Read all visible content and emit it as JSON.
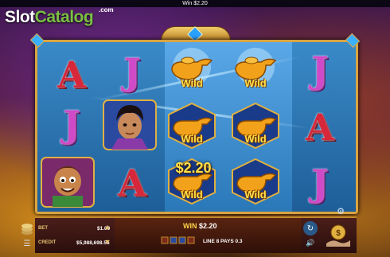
{
  "top": {
    "win_label": "Win $2.20"
  },
  "logo": {
    "part1": "Slot",
    "part2": "Catalog",
    "suffix": ".com"
  },
  "reels": [
    [
      "A",
      "J",
      "character-boy"
    ],
    [
      "J",
      "character-aladdin",
      "A"
    ],
    [
      "wild",
      "wild",
      "wild"
    ],
    [
      "wild",
      "wild",
      "wild"
    ],
    [
      "J",
      "A",
      "J"
    ]
  ],
  "wild_label": "Wild",
  "win_amount": "$2.20",
  "bottom_bar": {
    "bet_label": "BET",
    "bet_value": "$1.00",
    "credit_label": "CREDIT",
    "credit_value": "$5,988,698.55",
    "win_key": "WIN",
    "win_value": "$2.20",
    "payline_text": "LINE 8 PAYS 0.3"
  },
  "colors": {
    "frame": "#d9a441",
    "win_text": "#ffe04a",
    "a_symbol": "#d6283a",
    "j_symbol": "#d04ac8"
  }
}
